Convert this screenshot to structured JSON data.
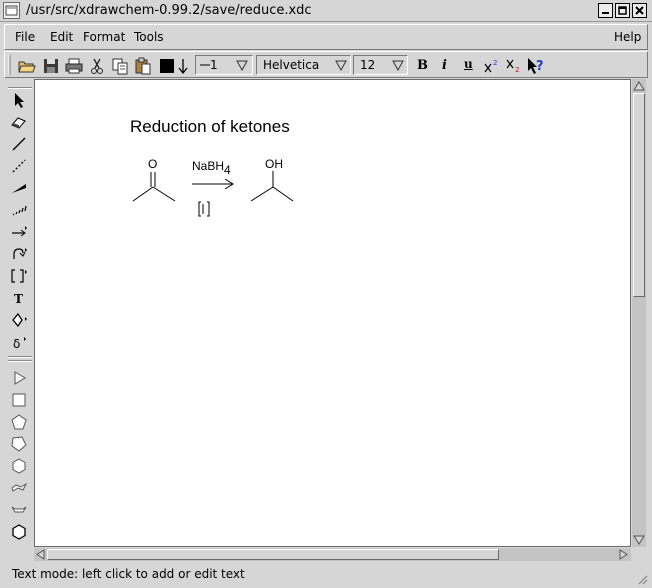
{
  "window": {
    "title": "/usr/src/xdrawchem-0.99.2/save/reduce.xdc"
  },
  "menu": {
    "file": "File",
    "edit": "Edit",
    "format": "Format",
    "tools": "Tools",
    "help": "Help"
  },
  "toolbar": {
    "line_width": "1",
    "font_family": "Helvetica",
    "font_size": "12",
    "bold_label": "B",
    "italic_label": "i",
    "underline_label": "u"
  },
  "canvas": {
    "heading": "Reduction of ketones",
    "ketone_atom": "O",
    "reagent": "NaBH",
    "reagent_subscript": "4",
    "alcohol_group": "OH"
  },
  "status": {
    "text": "Text mode: left click to add or edit text"
  },
  "icons": {
    "toolbar": [
      "open-folder-icon",
      "save-disk-icon",
      "print-icon",
      "cut-icon",
      "copy-icon",
      "paste-icon",
      "color-swatch-icon",
      "arrow-down-icon",
      "bold-icon",
      "italic-icon",
      "underline-icon",
      "superscript-icon",
      "subscript-icon",
      "whats-this-icon"
    ],
    "palette": [
      "select-arrow-icon",
      "eraser-icon",
      "line-bond-icon",
      "dashed-bond-icon",
      "wedge-bond-icon",
      "hashed-wedge-icon",
      "reaction-arrow-icon",
      "curved-arrow-icon",
      "bracket-icon",
      "text-tool-icon",
      "symbol-tool-icon",
      "orbital-tool-icon",
      "triangle-ring-icon",
      "square-ring-icon",
      "pentagon-ring-icon",
      "pentagon-alt-ring-icon",
      "hexagon-ring-icon",
      "chair-ring-icon",
      "boat-ring-icon",
      "hexagon-alt-ring-icon"
    ]
  }
}
